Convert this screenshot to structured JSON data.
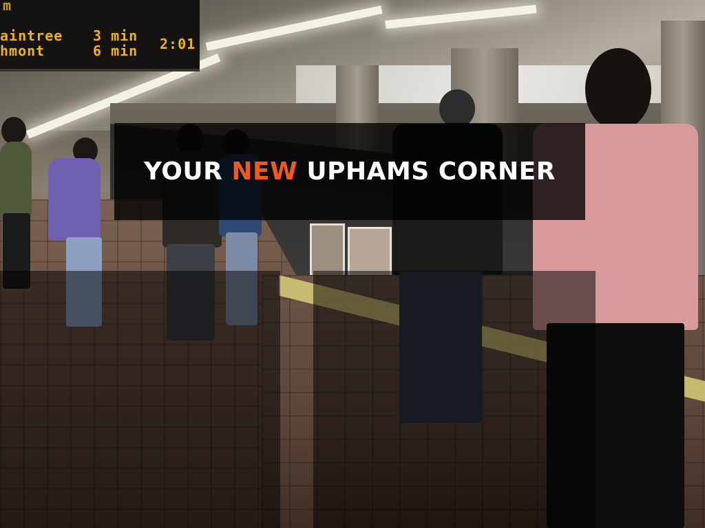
{
  "board": {
    "top_text": "m",
    "row1_dest": "aintree",
    "row2_dest": "hmont",
    "row1_min": "3 min",
    "row2_min": "6 min",
    "time": "2:01"
  },
  "headline": {
    "part1": "YOUR",
    "accent": "NEW",
    "part2": "UPHAMS CORNER"
  },
  "colors": {
    "accent": "#f05a1e",
    "headline_text": "#ffffff",
    "board_text": "#f2b414"
  }
}
